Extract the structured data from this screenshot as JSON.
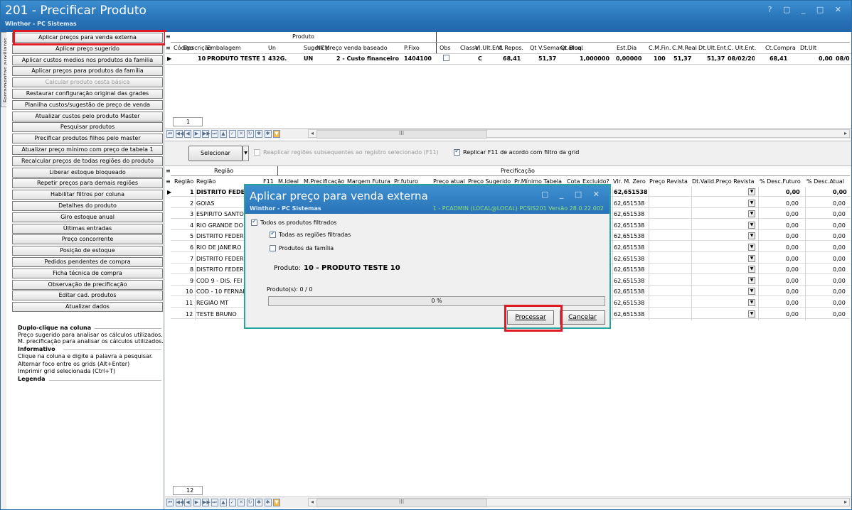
{
  "window": {
    "title": "201 - Precificar Produto",
    "subtitle": "Winthor - PC Sistemas",
    "controls": "? ▢ _ □ ✕"
  },
  "left_panel": {
    "vertical_tab": "Ferramentas auxiliares",
    "buttons": [
      {
        "label": "Aplicar preços para venda externa",
        "enabled": true
      },
      {
        "label": "Aplicar preço sugerido",
        "enabled": true
      },
      {
        "label": "Aplicar custos medios nos produtos da familia",
        "enabled": true
      },
      {
        "label": "Aplicar preços para produtos da família",
        "enabled": true
      },
      {
        "label": "Calcular produto cesta básica",
        "enabled": false
      },
      {
        "label": "Restaurar configuração original das grades",
        "enabled": true
      },
      {
        "label": "Planilha custos/sugestão de preço de venda",
        "enabled": true
      },
      {
        "label": "Atualizar custos pelo produto Master",
        "enabled": true
      },
      {
        "label": "Pesquisar produtos",
        "enabled": true
      },
      {
        "label": "Precificar produtos filhos pelo master",
        "enabled": true
      },
      {
        "label": "Atualizar preço mínimo com preço de tabela 1",
        "enabled": true
      },
      {
        "label": "Recalcular preços de todas regiões do produto",
        "enabled": true
      },
      {
        "label": "Liberar estoque bloqueado",
        "enabled": true
      },
      {
        "label": "Repetir preços para demais regiões",
        "enabled": true
      },
      {
        "label": "Habilitar filtros por coluna",
        "enabled": true
      },
      {
        "label": "Detalhes do produto",
        "enabled": true
      },
      {
        "label": "Giro estoque anual",
        "enabled": true
      },
      {
        "label": "Últimas entradas",
        "enabled": true
      },
      {
        "label": "Preço concorrente",
        "enabled": true
      },
      {
        "label": "Posição de estoque",
        "enabled": true
      },
      {
        "label": "Pedidos pendentes de compra",
        "enabled": true
      },
      {
        "label": "Ficha técnica de compra",
        "enabled": true
      },
      {
        "label": "Observação de precificação",
        "enabled": true
      },
      {
        "label": "Editar cad. produtos",
        "enabled": true
      },
      {
        "label": "Atualizar dados",
        "enabled": true
      }
    ],
    "info": {
      "double_click_title": "Duplo-clique na coluna",
      "double_click_lines": [
        "Preço sugerido para analisar os cálculos utilizados.",
        "M. precificação para analisar os cálculos utilizados."
      ],
      "info_title": "Informativo",
      "info_lines": [
        "Clique na coluna e digite a palavra a pesquisar.",
        "Alternar foco entre os grids (Alt+Enter)",
        "Imprimir grid selecionada (Ctrl+T)"
      ],
      "legend_title": "Legenda"
    }
  },
  "product_grid": {
    "group_header": "Produto",
    "columns": [
      "Código",
      "Descrição",
      "Embalagem",
      "Un",
      "Sugerir preço venda baseado",
      "NCM",
      "P.Fixo",
      "Obs",
      "Classe",
      "Vl.Ult.Ent.",
      "Vl Repos.",
      "Qt V.Semana atual",
      "Qt.Bloq.",
      "Est.Dia",
      "C.M.Fin.",
      "C.M.Real",
      "Dt.Ult.Ent.",
      "C. Ult.Ent.",
      "Ct.Compra",
      "Dt.Ult"
    ],
    "row": {
      "codigo": "10",
      "descricao": "PRODUTO TESTE 1",
      "embalagem": "432G.",
      "un": "UN",
      "sugerir": "2 - Custo financeiro",
      "ncm": "1404100",
      "classe": "C",
      "vl_ult_ent": "68,41",
      "vl_repos": "51,37",
      "qt_semana": "1,000000",
      "qt_bloq": "0,00000",
      "est_dia": "100",
      "cm_fin": "51,37",
      "cm_real": "51,37",
      "dt_ult_ent": "08/02/20",
      "c_ult_ent": "68,41",
      "ct_compra": "0,00",
      "dt_ult": "08/0"
    },
    "pager": "1"
  },
  "region_toolbar": {
    "select_label": "Selecionar",
    "reapply_label": "Reaplicar regiões subsequentes ao registro selecionado (F11)",
    "replicate_label": "Replicar F11 de acordo com filtro da grid"
  },
  "region_grid": {
    "group_region": "Região",
    "group_pricing": "Precificação",
    "columns": [
      "Região",
      "Região",
      "F11",
      "M.Ideal",
      "M.Precificação",
      "Margem Futura",
      "Pr.futuro",
      "Preço atual",
      "Preço Sugerido",
      "Pr.Mínimo Tabela",
      "Cota",
      "Excluido?",
      "Vlr. M. Zero",
      "Preço Revista",
      "Dt.Valid.Preço Revista",
      "% Desc.Futuro",
      "% Desc.Atual"
    ],
    "rows": [
      {
        "num": "1",
        "name": "DISTRITO FEDE",
        "zero": "62,651538",
        "df": "0,00",
        "da": "0,00"
      },
      {
        "num": "2",
        "name": "GOIAS",
        "zero": "62,651538",
        "df": "0,00",
        "da": "0,00"
      },
      {
        "num": "3",
        "name": "ESPIRITO SANTO",
        "zero": "62,651538",
        "df": "0,00",
        "da": "0,00"
      },
      {
        "num": "4",
        "name": "RIO GRANDE DO",
        "zero": "62,651538",
        "df": "0,00",
        "da": "0,00"
      },
      {
        "num": "5",
        "name": "DISTRITO FEDER",
        "zero": "62,651538",
        "df": "0,00",
        "da": "0,00"
      },
      {
        "num": "6",
        "name": "RIO DE JANEIRO",
        "zero": "62,651538",
        "df": "0,00",
        "da": "0,00"
      },
      {
        "num": "7",
        "name": "DISTRITO FEDER",
        "zero": "62,651538",
        "df": "0,00",
        "da": "0,00"
      },
      {
        "num": "8",
        "name": "DISTRITO FEDER",
        "zero": "62,651538",
        "df": "0,00",
        "da": "0,00"
      },
      {
        "num": "9",
        "name": "COD 9 - DIS. FEI",
        "zero": "62,651538",
        "df": "0,00",
        "da": "0,00"
      },
      {
        "num": "10",
        "name": "COD - 10 FERNAL",
        "zero": "62,651538",
        "df": "0,00",
        "da": "0,00"
      },
      {
        "num": "11",
        "name": "REGIÃO MT",
        "zero": "62,651538",
        "df": "0,00",
        "da": "0,00"
      },
      {
        "num": "12",
        "name": "TESTE BRUNO",
        "zero": "62,651538",
        "df": "0,00",
        "da": "0,00"
      }
    ],
    "pager": "12"
  },
  "dialog": {
    "title": "Aplicar preço para venda externa",
    "subtitle": "Winthor - PC Sistemas",
    "status": "1 - PCADMIN (LOCAL@LOCAL)   PCSIS201  Versão  28.0.22.002",
    "controls": "▢ _ □ ✕",
    "chk_all_products": "Todos os produtos filtrados",
    "chk_all_regions": "Todas as regiões filtradas",
    "chk_family": "Produtos da família",
    "product_label": "Produto:",
    "product_value": "10 - PRODUTO TESTE 10",
    "count_label": "Produto(s): 0 / 0",
    "progress_text": "0 %",
    "progress_value": 0,
    "process_label": "Processar",
    "cancel_label": "Cancelar"
  }
}
